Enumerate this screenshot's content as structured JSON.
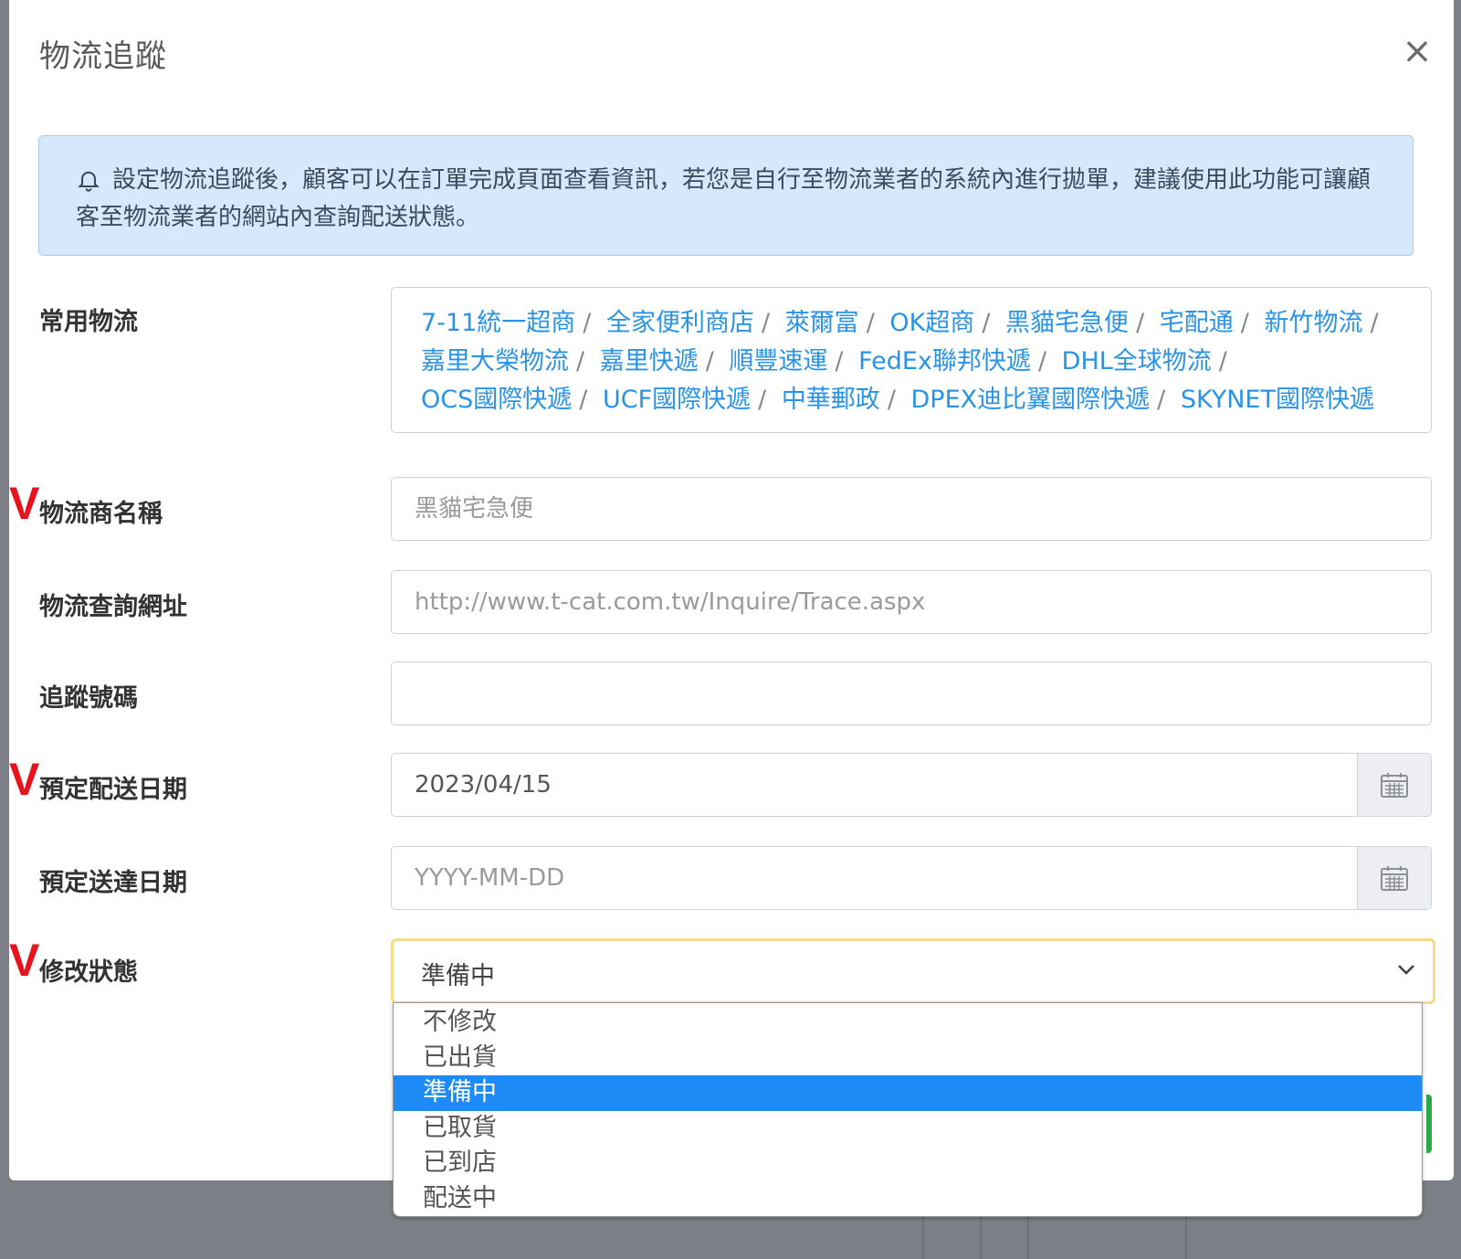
{
  "modal": {
    "title": "物流追蹤",
    "close_label": "×"
  },
  "alert": {
    "icon": "bell-icon",
    "text": "設定物流追蹤後，顧客可以在訂單完成頁面查看資訊，若您是自行至物流業者的系統內進行拋單，建議使用此功能可讓顧客至物流業者的網站內查詢配送狀態。"
  },
  "common_carriers": {
    "label": "常用物流",
    "separator": "/",
    "items": [
      "7-11統一超商",
      "全家便利商店",
      "萊爾富",
      "OK超商",
      "黑貓宅急便",
      "宅配通",
      "新竹物流",
      "嘉里大榮物流",
      "嘉里快遞",
      "順豐速運",
      "FedEx聯邦快遞",
      "DHL全球物流",
      "OCS國際快遞",
      "UCF國際快遞",
      "中華郵政",
      "DPEX迪比翼國際快遞",
      "SKYNET國際快遞"
    ]
  },
  "required_mark": "V",
  "form": {
    "carrier_name": {
      "label": "物流商名稱",
      "placeholder": "黑貓宅急便",
      "value": ""
    },
    "tracking_url": {
      "label": "物流查詢網址",
      "placeholder": "http://www.t-cat.com.tw/Inquire/Trace.aspx",
      "value": ""
    },
    "tracking_no": {
      "label": "追蹤號碼",
      "placeholder": "",
      "value": ""
    },
    "ship_date": {
      "label": "預定配送日期",
      "placeholder": "",
      "value": "2023/04/15"
    },
    "arrive_date": {
      "label": "預定送達日期",
      "placeholder": "YYYY-MM-DD",
      "value": ""
    },
    "status": {
      "label": "修改狀態",
      "selected": "準備中",
      "options": [
        "不修改",
        "已出貨",
        "準備中",
        "已取貨",
        "已到店",
        "配送中"
      ]
    }
  },
  "colors": {
    "link": "#2a93e8",
    "required": "#e8141d",
    "selected_option": "#1f8bf7",
    "alert_bg": "#d6e8fb"
  }
}
